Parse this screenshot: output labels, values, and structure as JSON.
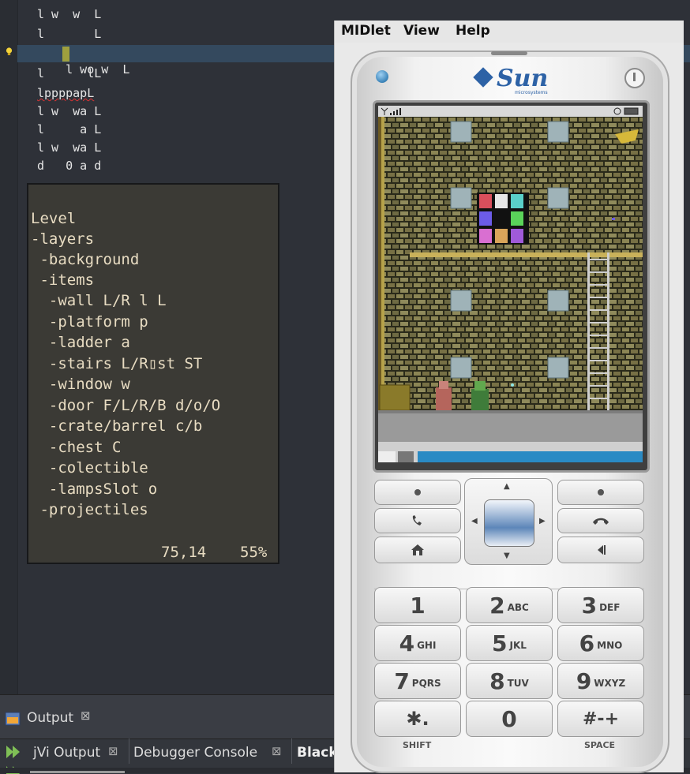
{
  "editor": {
    "code_lines": [
      "l w  w  L",
      "l       L",
      "l wo w  L",
      "l      lL",
      "lppppapL",
      "l w  wa L",
      "l     a L",
      "l w  wa L",
      "d   0 a d"
    ],
    "popup": {
      "tree": [
        "Level",
        "-layers",
        " -background",
        " -items",
        "  -wall L/R l L",
        "  -platform p",
        "  -ladder a",
        "  -stairs L/R▯st ST",
        "  -window w",
        "  -door F/L/R/B d/o/O",
        "  -crate/barrel c/b",
        "  -chest C",
        "  -colectible",
        "  -lampsSlot o",
        " -projectiles"
      ],
      "position": "75,14",
      "percent": "55%"
    }
  },
  "panels": {
    "output_label": "Output",
    "tabs": [
      "jVi Output",
      "Debugger Console",
      "BlackLamp (run)"
    ],
    "close_glyph": "⊠"
  },
  "emulator": {
    "menu": [
      "MIDlet",
      "View",
      "Help"
    ],
    "brand": "Sun",
    "brand_sub": "microsystems",
    "keys": [
      {
        "num": "1",
        "letters": ""
      },
      {
        "num": "2",
        "letters": "ABC"
      },
      {
        "num": "3",
        "letters": "DEF"
      },
      {
        "num": "4",
        "letters": "GHI"
      },
      {
        "num": "5",
        "letters": "JKL"
      },
      {
        "num": "6",
        "letters": "MNO"
      },
      {
        "num": "7",
        "letters": "PQRS"
      },
      {
        "num": "8",
        "letters": "TUV"
      },
      {
        "num": "9",
        "letters": "WXYZ"
      },
      {
        "num": "✱.",
        "letters": ""
      },
      {
        "num": "0",
        "letters": ""
      },
      {
        "num": "#-+",
        "letters": ""
      }
    ],
    "shift_label": "SHIFT",
    "space_label": "SPACE"
  },
  "colors": {
    "accent": "#2d62a6",
    "editor_bg": "#2e3138",
    "popup_bg": "#3b3a35",
    "highlight": "#f5e625"
  }
}
